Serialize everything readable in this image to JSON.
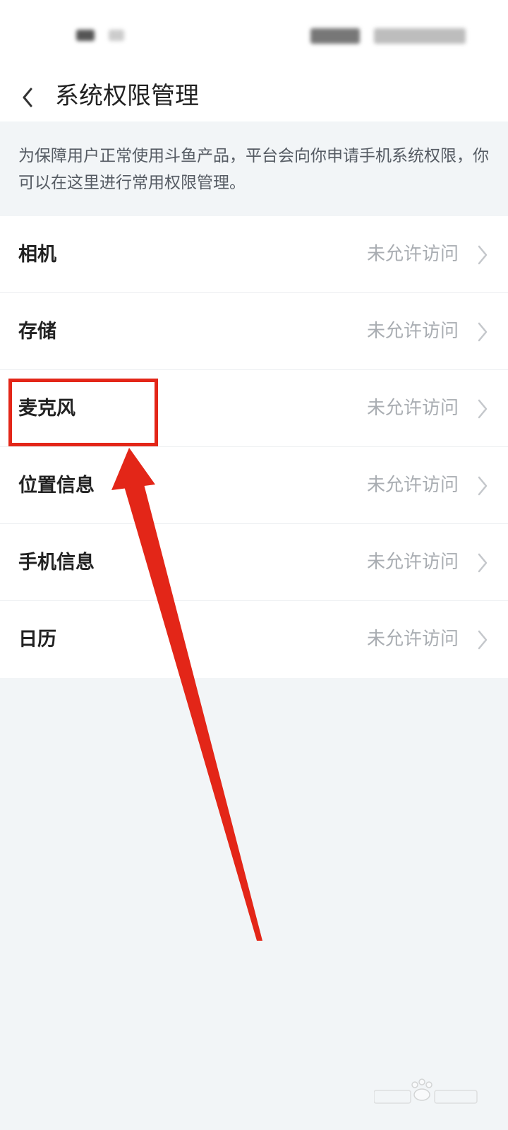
{
  "header": {
    "back_icon": "chevron-left-icon",
    "title": "系统权限管理"
  },
  "notice": {
    "text": "为保障用户正常使用斗鱼产品，平台会向你申请手机系统权限，你可以在这里进行常用权限管理。"
  },
  "permissions": [
    {
      "name": "相机",
      "status": "未允许访问"
    },
    {
      "name": "存储",
      "status": "未允许访问"
    },
    {
      "name": "麦克风",
      "status": "未允许访问"
    },
    {
      "name": "位置信息",
      "status": "未允许访问"
    },
    {
      "name": "手机信息",
      "status": "未允许访问"
    },
    {
      "name": "日历",
      "status": "未允许访问"
    }
  ],
  "colors": {
    "annotation": "#e32618",
    "background": "#f2f5f7",
    "status_text": "#a9adb2"
  }
}
